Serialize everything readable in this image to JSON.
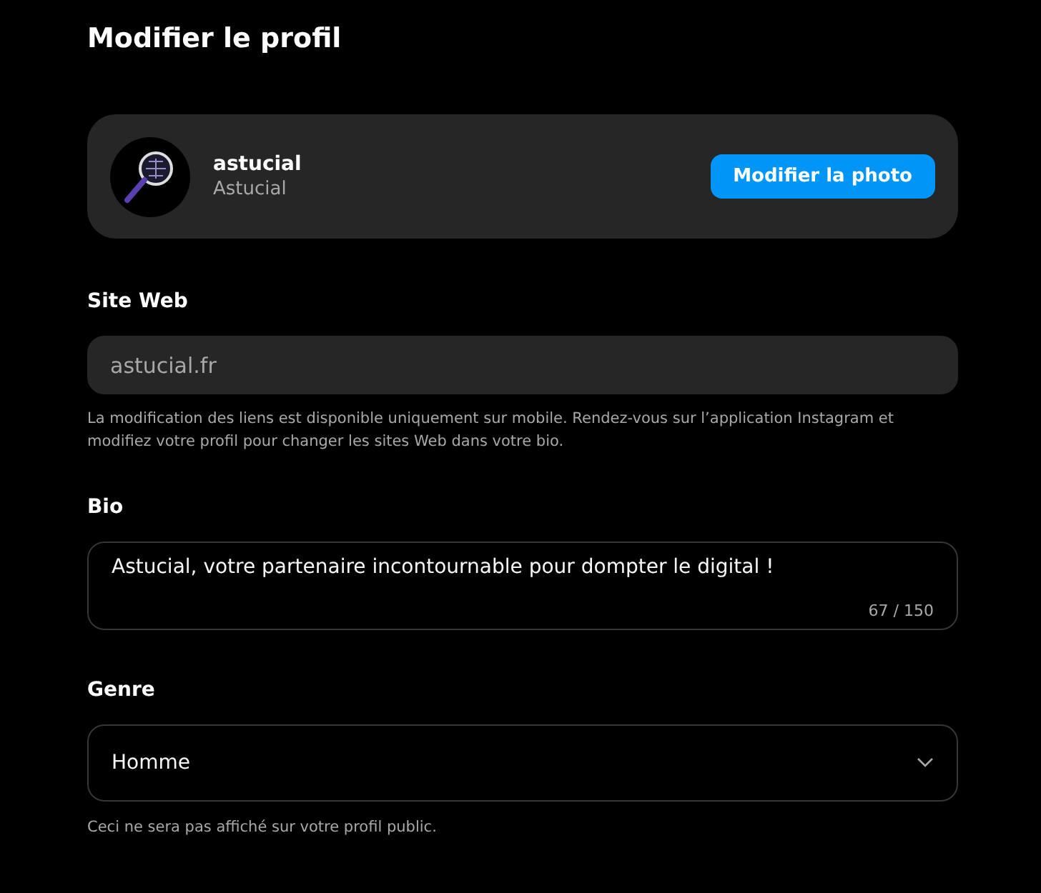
{
  "title": "Modifier le profil",
  "profile": {
    "username": "astucial",
    "name": "Astucial",
    "button": "Modifier la photo"
  },
  "website": {
    "label": "Site Web",
    "placeholder": "astucial.fr",
    "disabled": true,
    "help": "La modification des liens est disponible uniquement sur mobile. Rendez-vous sur l’application Instagram et modifiez votre profil pour changer les sites Web dans votre bio."
  },
  "bio": {
    "label": "Bio",
    "value": "Astucial, votre partenaire incontournable pour dompter le digital !",
    "counter": "67 / 150"
  },
  "gender": {
    "label": "Genre",
    "value": "Homme",
    "help": "Ceci ne sera pas affiché sur votre profil public."
  }
}
